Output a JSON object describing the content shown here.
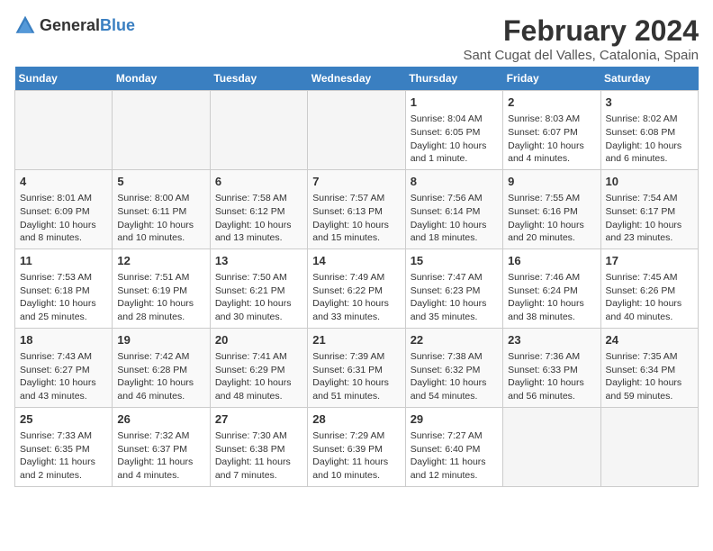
{
  "header": {
    "logo_general": "General",
    "logo_blue": "Blue",
    "main_title": "February 2024",
    "subtitle": "Sant Cugat del Valles, Catalonia, Spain"
  },
  "weekdays": [
    "Sunday",
    "Monday",
    "Tuesday",
    "Wednesday",
    "Thursday",
    "Friday",
    "Saturday"
  ],
  "weeks": [
    [
      {
        "day": "",
        "info": ""
      },
      {
        "day": "",
        "info": ""
      },
      {
        "day": "",
        "info": ""
      },
      {
        "day": "",
        "info": ""
      },
      {
        "day": "1",
        "info": "Sunrise: 8:04 AM\nSunset: 6:05 PM\nDaylight: 10 hours and 1 minute."
      },
      {
        "day": "2",
        "info": "Sunrise: 8:03 AM\nSunset: 6:07 PM\nDaylight: 10 hours and 4 minutes."
      },
      {
        "day": "3",
        "info": "Sunrise: 8:02 AM\nSunset: 6:08 PM\nDaylight: 10 hours and 6 minutes."
      }
    ],
    [
      {
        "day": "4",
        "info": "Sunrise: 8:01 AM\nSunset: 6:09 PM\nDaylight: 10 hours and 8 minutes."
      },
      {
        "day": "5",
        "info": "Sunrise: 8:00 AM\nSunset: 6:11 PM\nDaylight: 10 hours and 10 minutes."
      },
      {
        "day": "6",
        "info": "Sunrise: 7:58 AM\nSunset: 6:12 PM\nDaylight: 10 hours and 13 minutes."
      },
      {
        "day": "7",
        "info": "Sunrise: 7:57 AM\nSunset: 6:13 PM\nDaylight: 10 hours and 15 minutes."
      },
      {
        "day": "8",
        "info": "Sunrise: 7:56 AM\nSunset: 6:14 PM\nDaylight: 10 hours and 18 minutes."
      },
      {
        "day": "9",
        "info": "Sunrise: 7:55 AM\nSunset: 6:16 PM\nDaylight: 10 hours and 20 minutes."
      },
      {
        "day": "10",
        "info": "Sunrise: 7:54 AM\nSunset: 6:17 PM\nDaylight: 10 hours and 23 minutes."
      }
    ],
    [
      {
        "day": "11",
        "info": "Sunrise: 7:53 AM\nSunset: 6:18 PM\nDaylight: 10 hours and 25 minutes."
      },
      {
        "day": "12",
        "info": "Sunrise: 7:51 AM\nSunset: 6:19 PM\nDaylight: 10 hours and 28 minutes."
      },
      {
        "day": "13",
        "info": "Sunrise: 7:50 AM\nSunset: 6:21 PM\nDaylight: 10 hours and 30 minutes."
      },
      {
        "day": "14",
        "info": "Sunrise: 7:49 AM\nSunset: 6:22 PM\nDaylight: 10 hours and 33 minutes."
      },
      {
        "day": "15",
        "info": "Sunrise: 7:47 AM\nSunset: 6:23 PM\nDaylight: 10 hours and 35 minutes."
      },
      {
        "day": "16",
        "info": "Sunrise: 7:46 AM\nSunset: 6:24 PM\nDaylight: 10 hours and 38 minutes."
      },
      {
        "day": "17",
        "info": "Sunrise: 7:45 AM\nSunset: 6:26 PM\nDaylight: 10 hours and 40 minutes."
      }
    ],
    [
      {
        "day": "18",
        "info": "Sunrise: 7:43 AM\nSunset: 6:27 PM\nDaylight: 10 hours and 43 minutes."
      },
      {
        "day": "19",
        "info": "Sunrise: 7:42 AM\nSunset: 6:28 PM\nDaylight: 10 hours and 46 minutes."
      },
      {
        "day": "20",
        "info": "Sunrise: 7:41 AM\nSunset: 6:29 PM\nDaylight: 10 hours and 48 minutes."
      },
      {
        "day": "21",
        "info": "Sunrise: 7:39 AM\nSunset: 6:31 PM\nDaylight: 10 hours and 51 minutes."
      },
      {
        "day": "22",
        "info": "Sunrise: 7:38 AM\nSunset: 6:32 PM\nDaylight: 10 hours and 54 minutes."
      },
      {
        "day": "23",
        "info": "Sunrise: 7:36 AM\nSunset: 6:33 PM\nDaylight: 10 hours and 56 minutes."
      },
      {
        "day": "24",
        "info": "Sunrise: 7:35 AM\nSunset: 6:34 PM\nDaylight: 10 hours and 59 minutes."
      }
    ],
    [
      {
        "day": "25",
        "info": "Sunrise: 7:33 AM\nSunset: 6:35 PM\nDaylight: 11 hours and 2 minutes."
      },
      {
        "day": "26",
        "info": "Sunrise: 7:32 AM\nSunset: 6:37 PM\nDaylight: 11 hours and 4 minutes."
      },
      {
        "day": "27",
        "info": "Sunrise: 7:30 AM\nSunset: 6:38 PM\nDaylight: 11 hours and 7 minutes."
      },
      {
        "day": "28",
        "info": "Sunrise: 7:29 AM\nSunset: 6:39 PM\nDaylight: 11 hours and 10 minutes."
      },
      {
        "day": "29",
        "info": "Sunrise: 7:27 AM\nSunset: 6:40 PM\nDaylight: 11 hours and 12 minutes."
      },
      {
        "day": "",
        "info": ""
      },
      {
        "day": "",
        "info": ""
      }
    ]
  ]
}
